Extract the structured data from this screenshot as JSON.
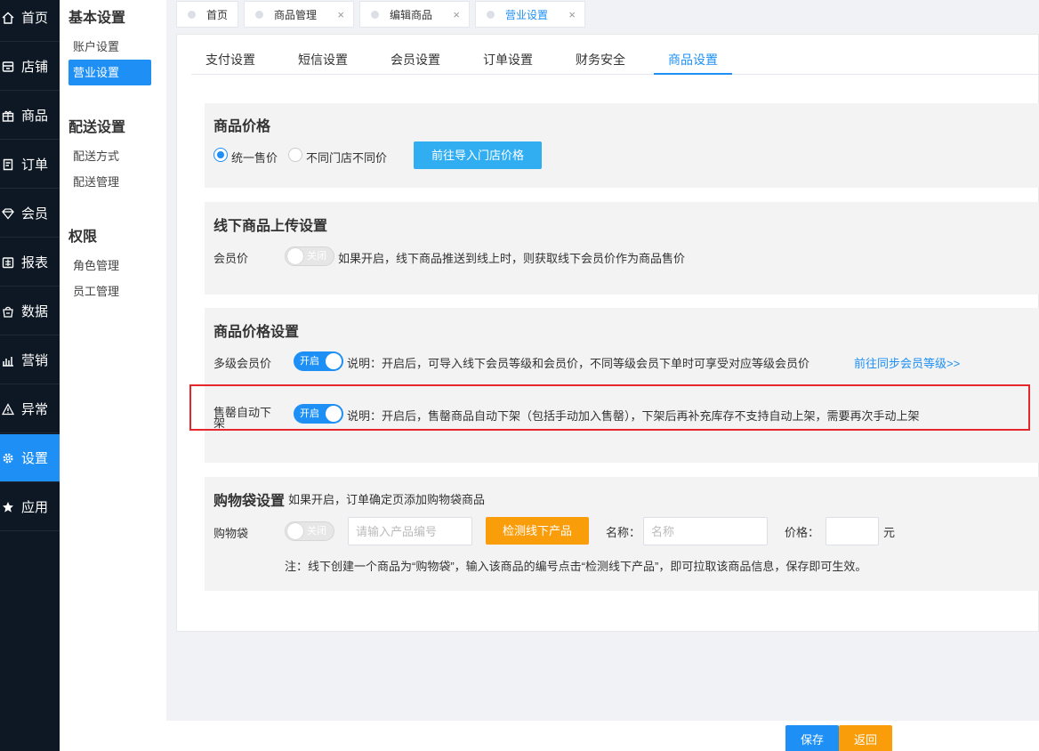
{
  "nav": [
    {
      "label": "首页",
      "icon": "home-icon"
    },
    {
      "label": "店铺",
      "icon": "store-icon"
    },
    {
      "label": "商品",
      "icon": "gift-icon"
    },
    {
      "label": "订单",
      "icon": "order-icon"
    },
    {
      "label": "会员",
      "icon": "member-icon"
    },
    {
      "label": "报表",
      "icon": "report-icon"
    },
    {
      "label": "数据",
      "icon": "data-icon"
    },
    {
      "label": "营销",
      "icon": "marketing-icon"
    },
    {
      "label": "异常",
      "icon": "warning-icon"
    },
    {
      "label": "设置",
      "icon": "gear-icon"
    },
    {
      "label": "应用",
      "icon": "star-icon"
    }
  ],
  "subnav": {
    "group1": "基本设置",
    "account": "账户设置",
    "business": "营业设置",
    "group2": "配送设置",
    "delivery_method": "配送方式",
    "delivery_manage": "配送管理",
    "group3": "权限",
    "role": "角色管理",
    "staff": "员工管理"
  },
  "page_tabs": [
    {
      "label": "首页"
    },
    {
      "label": "商品管理",
      "close": "×"
    },
    {
      "label": "编辑商品",
      "close": "×"
    },
    {
      "label": "营业设置",
      "close": "×"
    }
  ],
  "settings_tabs": [
    "支付设置",
    "短信设置",
    "会员设置",
    "订单设置",
    "财务安全",
    "商品设置"
  ],
  "price": {
    "title": "商品价格",
    "opt_unified": "统一售价",
    "opt_diff": "不同门店不同价",
    "import_btn": "前往导入门店价格"
  },
  "offline": {
    "title": "线下商品上传设置",
    "member_price_label": "会员价",
    "switch_text": "关闭",
    "desc": "如果开启，线下商品推送到线上时，则获取线下会员价作为商品售价"
  },
  "price_settings": {
    "title": "商品价格设置",
    "multi_label": "多级会员价",
    "multi_switch": "开启",
    "multi_desc": "说明：开启后，可导入线下会员等级和会员价，不同等级会员下单时可享受对应等级会员价",
    "multi_link": "前往同步会员等级>>",
    "soldout_label": "售罄自动下架",
    "soldout_switch": "开启",
    "soldout_desc": "说明：开启后，售罄商品自动下架（包括手动加入售罄），下架后再补充库存不支持自动上架，需要再次手动上架"
  },
  "bag": {
    "title": "购物袋设置",
    "subtitle": "如果开启，订单确定页添加购物袋商品",
    "label": "购物袋",
    "switch_text": "关闭",
    "code_placeholder": "请输入产品编号",
    "detect_btn": "检测线下产品",
    "name_label": "名称：",
    "name_placeholder": "名称",
    "price_label": "价格：",
    "price_unit": "元",
    "note": "注：线下创建一个商品为“购物袋”，输入该商品的编号点击“检测线下产品”，即可拉取该商品信息，保存即可生效。"
  },
  "footer": {
    "save": "保存",
    "back": "返回"
  },
  "colors": {
    "primary": "#1e90f5",
    "warning": "#fa9d0b",
    "highlight": "#e5262b",
    "nav_bg": "#0e1824"
  }
}
